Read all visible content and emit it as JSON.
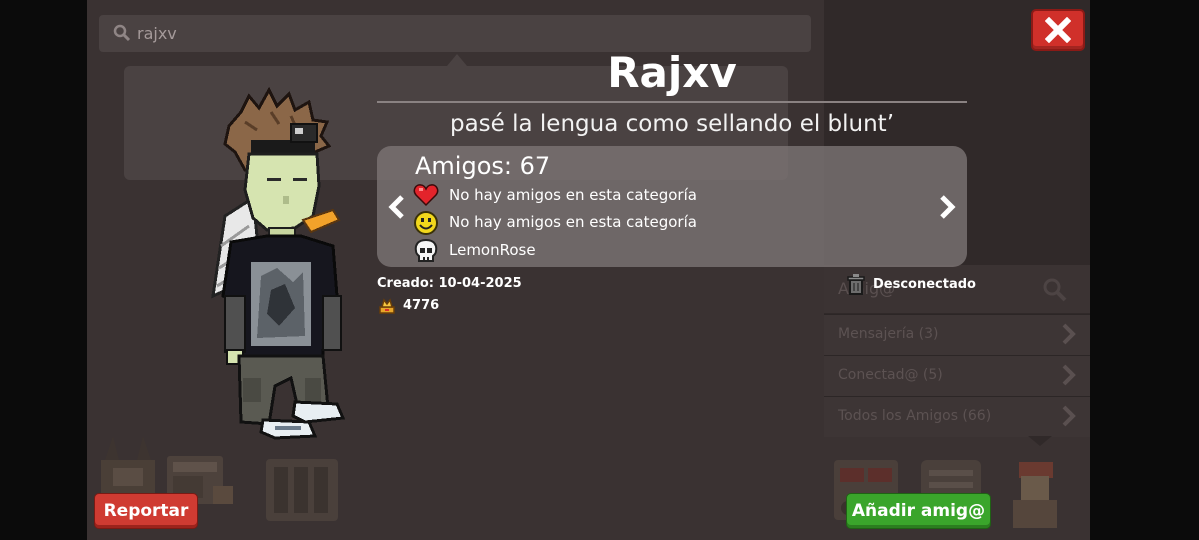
{
  "search": {
    "value": "rajxv"
  },
  "profile": {
    "username": "Rajxv",
    "motto": "pasé la lengua como sellando el blunt’",
    "friends_label": "Amigos: 67",
    "categories": [
      {
        "icon": "heart-icon",
        "label": "No hay amigos en esta categoría"
      },
      {
        "icon": "smiley-icon",
        "label": "No hay amigos en esta categoría"
      },
      {
        "icon": "skull-icon",
        "label": "LemonRose"
      }
    ],
    "created": "Creado: 10-04-2025",
    "score": "4776",
    "status": "Desconectado"
  },
  "buttons": {
    "report": "Reportar",
    "add_friend": "Añadir amig@"
  },
  "friends_panel": {
    "header": "Amig@",
    "rows": [
      "Mensajería (3)",
      "Conectad@ (5)",
      "Todos los Amigos (66)"
    ]
  },
  "colors": {
    "close": "#d0302a",
    "report": "#cf3b32",
    "add": "#3aa52b",
    "background": "#3a3232"
  }
}
